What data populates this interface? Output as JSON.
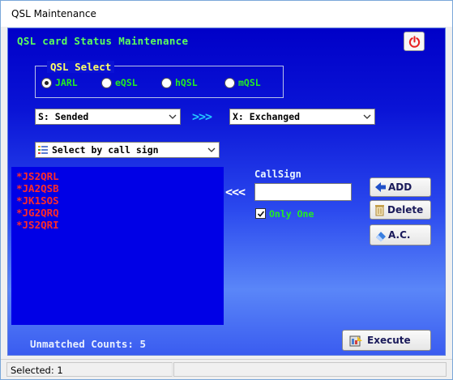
{
  "window": {
    "title": "QSL Maintenance"
  },
  "header": {
    "label": "QSL card Status Maintenance",
    "power_icon": "power-icon"
  },
  "qsl_select": {
    "legend": "QSL Select",
    "options": [
      "JARL",
      "eQSL",
      "hQSL",
      "mQSL"
    ],
    "selected": "JARL"
  },
  "status_from": {
    "value": "S: Sended"
  },
  "arrows_right": ">>>",
  "status_to": {
    "value": "X: Exchanged"
  },
  "select_mode": {
    "value": "Select by call sign",
    "icon": "list-icon"
  },
  "callsign_list": [
    "*JS2QRL",
    "*JA2QSB",
    "*JK1SOS",
    "*JG2QRQ",
    "*JS2QRI"
  ],
  "arrows_left": "<<<",
  "callsign": {
    "label": "CallSign",
    "value": ""
  },
  "only_one": {
    "label": "Only One",
    "checked": true
  },
  "buttons": {
    "add": "ADD",
    "delete": "Delete",
    "ac": "A.C.",
    "execute": "Execute"
  },
  "unmatched": {
    "label": "Unmatched Counts: 5"
  },
  "statusbar": {
    "text": "Selected: 1",
    "text2": ""
  },
  "colors": {
    "panel": "#0a14d6",
    "green_text": "#22ee22",
    "yellow_text": "#ffff66",
    "list_text": "#ff2a2a",
    "arrow_cyan": "#23c6ff"
  }
}
